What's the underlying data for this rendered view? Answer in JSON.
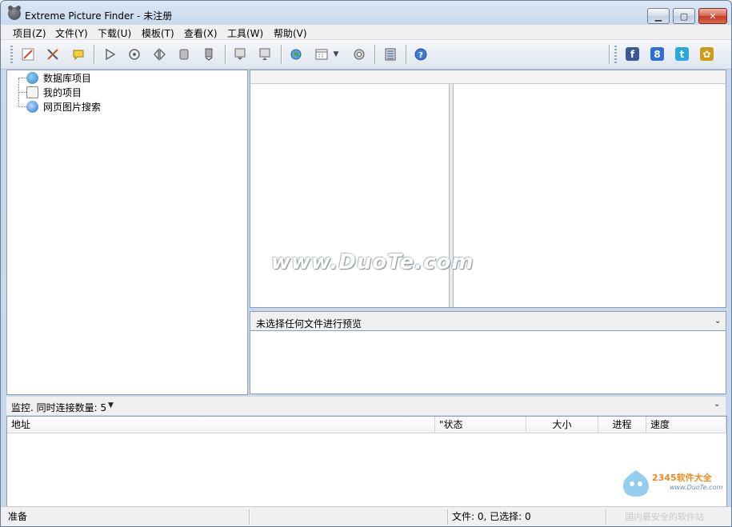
{
  "window": {
    "title": "Extreme Picture Finder - 未注册",
    "controls": {
      "minimize": "▁",
      "maximize": "▢",
      "close": "✕"
    }
  },
  "menu": [
    "项目(Z)",
    "文件(Y)",
    "下载(U)",
    "模板(T)",
    "查看(X)",
    "工具(W)",
    "帮助(V)"
  ],
  "toolbar": {
    "buttons": [
      "edit-project-icon",
      "tools-icon",
      "comment-icon",
      "play-icon",
      "target-icon",
      "step-icon",
      "stop-icon",
      "download-icon",
      "import-icon",
      "export-icon",
      "web-icon",
      "calendar-icon",
      "settings-icon",
      "filmstrip-icon",
      "help-icon"
    ],
    "social": [
      {
        "name": "facebook-icon",
        "glyph": "f",
        "color": "#3b5998"
      },
      {
        "name": "google-plus-icon",
        "glyph": "8",
        "color": "#2d6fd3"
      },
      {
        "name": "twitter-icon",
        "glyph": "t",
        "color": "#2aa9e0"
      },
      {
        "name": "community-icon",
        "glyph": "✿",
        "color": "#cf9a14"
      }
    ]
  },
  "tree": {
    "items": [
      {
        "label": "数据库项目",
        "icon": "globe-database-icon"
      },
      {
        "label": "我的项目",
        "icon": "project-folder-icon"
      },
      {
        "label": "网页图片搜索",
        "icon": "web-search-icon"
      }
    ]
  },
  "watermark": "www.DuoTe.com",
  "preview": {
    "label": "未选择任何文件进行预览"
  },
  "monitor": {
    "label": "监控. 同时连接数量: 5"
  },
  "download_list": {
    "columns": [
      "地址",
      "\"状态",
      "大小",
      "进程",
      "速度"
    ]
  },
  "status": {
    "left": "准备",
    "files": "文件: 0, 已选择: 0"
  },
  "logo_2345": {
    "brand": "2345软件大全",
    "url": "www.DuoTe.com",
    "footer": "国内最安全的软件站"
  }
}
